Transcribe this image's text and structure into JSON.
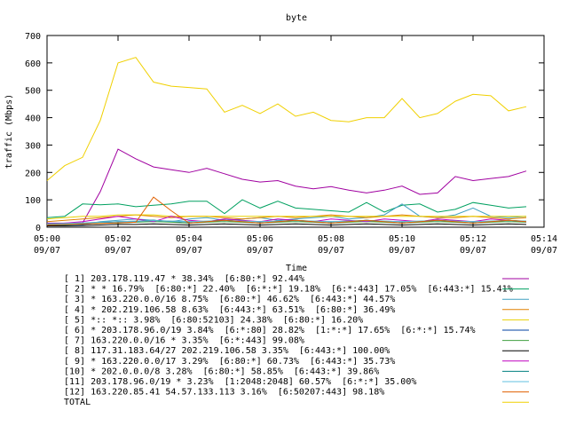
{
  "chart_data": {
    "type": "line",
    "title": "byte",
    "xlabel": "Time",
    "ylabel": "traffic (Mbps)",
    "ylim": [
      0,
      700
    ],
    "yticks": [
      "0",
      "100",
      "200",
      "300",
      "400",
      "500",
      "600",
      "700"
    ],
    "xlim": [
      "05:00",
      "05:14"
    ],
    "xticks": [
      {
        "time": "05:00",
        "date": "09/07"
      },
      {
        "time": "05:02",
        "date": "09/07"
      },
      {
        "time": "05:04",
        "date": "09/07"
      },
      {
        "time": "05:06",
        "date": "09/07"
      },
      {
        "time": "05:08",
        "date": "09/07"
      },
      {
        "time": "05:10",
        "date": "09/07"
      },
      {
        "time": "05:12",
        "date": "09/07"
      },
      {
        "time": "05:14",
        "date": "09/07"
      }
    ],
    "grid": false,
    "legend_position": "bottom",
    "x": [
      "05:00",
      "05:00:30",
      "05:01",
      "05:01:30",
      "05:02",
      "05:02:30",
      "05:03",
      "05:03:30",
      "05:04",
      "05:04:30",
      "05:05",
      "05:05:30",
      "05:06",
      "05:06:30",
      "05:07",
      "05:07:30",
      "05:08",
      "05:08:30",
      "05:09",
      "05:09:30",
      "05:10",
      "05:10:30",
      "05:11",
      "05:11:30",
      "05:12",
      "05:12:30",
      "05:13",
      "05:13:30"
    ],
    "series": [
      {
        "name": "[ 1] 203.178.119.47 * 38.34%  [6:80:*] 92.44%",
        "color": "#a000a0",
        "values": [
          15,
          15,
          15,
          130,
          285,
          250,
          220,
          210,
          200,
          215,
          195,
          175,
          165,
          170,
          150,
          140,
          148,
          135,
          125,
          135,
          150,
          120,
          125,
          185,
          170,
          178,
          185,
          205
        ]
      },
      {
        "name": "[ 2] * * 16.79%  [6:80:*] 22.40%  [6:*:*] 19.18%  [6:*:443] 17.05%  [6:443:*] 15.41%",
        "color": "#00a060",
        "values": [
          35,
          40,
          85,
          82,
          85,
          75,
          80,
          85,
          95,
          95,
          50,
          100,
          70,
          95,
          70,
          65,
          60,
          55,
          90,
          55,
          80,
          85,
          55,
          65,
          90,
          80,
          70,
          75
        ]
      },
      {
        "name": "[ 3] * 163.220.0.0/16 8.75%  [6:80:*] 46.62%  [6:443:*] 44.57%",
        "color": "#40a0c0",
        "values": [
          5,
          8,
          10,
          20,
          25,
          30,
          25,
          20,
          30,
          35,
          25,
          30,
          35,
          25,
          30,
          35,
          40,
          30,
          35,
          45,
          85,
          40,
          35,
          45,
          70,
          40,
          35,
          40
        ]
      },
      {
        "name": "[ 4] * 202.219.106.58 8.63%  [6:443:*] 63.51%  [6:80:*] 36.49%",
        "color": "#e08000",
        "values": [
          20,
          25,
          30,
          35,
          40,
          45,
          40,
          35,
          40,
          40,
          35,
          30,
          35,
          40,
          35,
          40,
          45,
          40,
          35,
          40,
          45,
          40,
          35,
          35,
          40,
          35,
          30,
          35
        ]
      },
      {
        "name": "[ 5] *:: *:: 3.98%  [6:80:52103] 24.38%  [6:80:*] 16.20%",
        "color": "#e8d000",
        "values": [
          30,
          35,
          40,
          40,
          45,
          45,
          45,
          40,
          40,
          40,
          40,
          40,
          40,
          40,
          40,
          40,
          40,
          40,
          40,
          40,
          40,
          40,
          40,
          40,
          40,
          40,
          40,
          40
        ]
      },
      {
        "name": "[ 6] * 203.178.96.0/19 3.84%  [6:*:80] 28.82%  [1:*:*] 17.65%  [6:*:*] 15.74%",
        "color": "#0040a0",
        "values": [
          10,
          12,
          10,
          15,
          20,
          20,
          25,
          20,
          15,
          20,
          25,
          20,
          15,
          20,
          25,
          20,
          15,
          20,
          25,
          20,
          15,
          20,
          25,
          20,
          15,
          20,
          25,
          20
        ]
      },
      {
        "name": "[ 7] 163.220.0.0/16 * 3.35%  [6:*:443] 99.08%",
        "color": "#40a040",
        "values": [
          8,
          10,
          12,
          15,
          15,
          18,
          20,
          18,
          15,
          18,
          20,
          18,
          15,
          18,
          20,
          18,
          15,
          18,
          20,
          18,
          15,
          18,
          20,
          18,
          15,
          18,
          20,
          18
        ]
      },
      {
        "name": "[ 8] 117.31.183.64/27 202.219.106.58 3.35%  [6:443:*] 100.00%",
        "color": "#000000",
        "values": [
          5,
          5,
          6,
          8,
          10,
          10,
          12,
          10,
          8,
          10,
          12,
          10,
          8,
          10,
          12,
          10,
          8,
          10,
          12,
          10,
          8,
          10,
          12,
          10,
          8,
          10,
          12,
          10
        ]
      },
      {
        "name": "[ 9] * 163.220.0.0/17 3.29%  [6:80:*] 60.73%  [6:443:*] 35.73%",
        "color": "#c000c0",
        "values": [
          10,
          15,
          20,
          30,
          40,
          30,
          20,
          40,
          25,
          20,
          30,
          25,
          20,
          30,
          25,
          20,
          30,
          25,
          20,
          30,
          25,
          20,
          30,
          25,
          20,
          30,
          25,
          20
        ]
      },
      {
        "name": "[10] * 202.0.0.0/8 3.28%  [6:80:*] 58.85%  [6:443:*] 39.86%",
        "color": "#008080",
        "values": [
          10,
          12,
          15,
          18,
          20,
          22,
          25,
          22,
          20,
          22,
          25,
          22,
          20,
          22,
          25,
          22,
          20,
          22,
          25,
          22,
          20,
          22,
          25,
          22,
          20,
          22,
          25,
          22
        ]
      },
      {
        "name": "[11] 203.178.96.0/19 * 3.23%  [1:2048:2048] 60.57%  [6:*:*] 35.00%",
        "color": "#60c0e0",
        "values": [
          12,
          14,
          16,
          18,
          20,
          22,
          24,
          22,
          20,
          22,
          24,
          22,
          20,
          22,
          24,
          22,
          20,
          22,
          24,
          22,
          20,
          22,
          24,
          22,
          20,
          22,
          24,
          22
        ]
      },
      {
        "name": "[12] 163.220.85.41 54.57.133.113 3.16%  [6:50207:443] 98.18%",
        "color": "#e06000",
        "values": [
          8,
          10,
          12,
          14,
          16,
          18,
          110,
          60,
          15,
          20,
          25,
          20,
          15,
          20,
          25,
          20,
          15,
          20,
          25,
          20,
          15,
          20,
          25,
          20,
          15,
          20,
          25,
          20
        ]
      },
      {
        "name": "TOTAL",
        "color": "#f0d000",
        "values": [
          170,
          225,
          255,
          390,
          600,
          620,
          530,
          515,
          510,
          505,
          420,
          445,
          415,
          450,
          405,
          420,
          390,
          385,
          400,
          400,
          470,
          400,
          415,
          460,
          485,
          480,
          425,
          440
        ]
      }
    ]
  }
}
